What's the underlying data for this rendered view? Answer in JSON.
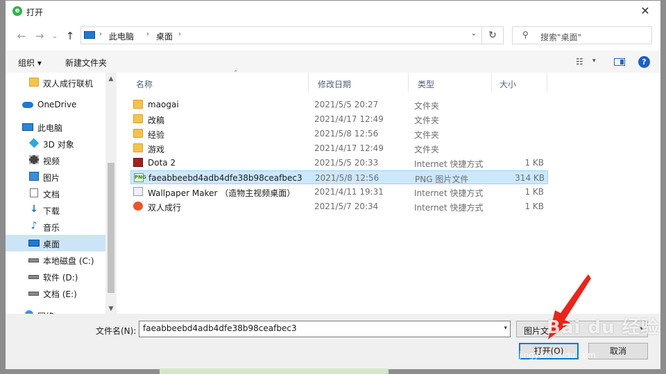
{
  "window": {
    "title": "打开",
    "close_glyph": "✕"
  },
  "nav": {
    "back_glyph": "←",
    "forward_glyph": "→",
    "recent_glyph": "⌄",
    "up_glyph": "↑",
    "address": {
      "crumbs": [
        "此电脑",
        "桌面"
      ],
      "sep_glyph": "›",
      "dropdown_glyph": "⌄",
      "refresh_glyph": "↻"
    },
    "search": {
      "placeholder": "搜索\"桌面\"",
      "icon": "search-icon"
    }
  },
  "toolbar": {
    "organize_label": "组织 ▾",
    "new_folder_label": "新建文件夹",
    "view_glyph": "☷",
    "view_dd": "▾",
    "help_glyph": "?"
  },
  "navpane": {
    "items": [
      {
        "label": "双人成行联机",
        "icon": "folder-icon"
      },
      {
        "label": "OneDrive",
        "icon": "cloud-icon"
      },
      {
        "label": "此电脑",
        "icon": "computer-icon"
      },
      {
        "label": "3D 对象",
        "icon": "cube-icon"
      },
      {
        "label": "视频",
        "icon": "video-icon"
      },
      {
        "label": "图片",
        "icon": "picture-icon"
      },
      {
        "label": "文档",
        "icon": "document-icon"
      },
      {
        "label": "下载",
        "icon": "download-icon",
        "glyph": "↓"
      },
      {
        "label": "音乐",
        "icon": "music-icon",
        "glyph": "♪"
      },
      {
        "label": "桌面",
        "icon": "desktop-icon",
        "selected": true
      },
      {
        "label": "本地磁盘 (C:)",
        "icon": "drive-icon"
      },
      {
        "label": "软件 (D:)",
        "icon": "drive-icon"
      },
      {
        "label": "文档 (E:)",
        "icon": "drive-icon"
      },
      {
        "label": "网络",
        "icon": "network-icon"
      }
    ],
    "scroll_up": "▲",
    "scroll_down": "▼"
  },
  "columns": {
    "name": "名称",
    "date": "修改日期",
    "type": "类型",
    "size": "大小",
    "sort_glyph": "⌃"
  },
  "files": [
    {
      "name": "maogai",
      "date": "2021/5/5 20:27",
      "type": "文件夹",
      "size": "",
      "icon": "folder"
    },
    {
      "name": "改稿",
      "date": "2021/4/17 12:49",
      "type": "文件夹",
      "size": "",
      "icon": "folder"
    },
    {
      "name": "经验",
      "date": "2021/5/8 12:56",
      "type": "文件夹",
      "size": "",
      "icon": "folder"
    },
    {
      "name": "游戏",
      "date": "2021/4/17 12:49",
      "type": "文件夹",
      "size": "",
      "icon": "folder"
    },
    {
      "name": "Dota 2",
      "date": "2021/5/5 20:33",
      "type": "Internet 快捷方式",
      "size": "1 KB",
      "icon": "dota"
    },
    {
      "name": "faeabbeebd4adb4dfe38b98ceafbec3",
      "date": "2021/5/8 12:56",
      "type": "PNG 图片文件",
      "size": "314 KB",
      "icon": "png",
      "selected": true
    },
    {
      "name": "Wallpaper Maker （造物主视频桌面）",
      "date": "2021/4/11 19:31",
      "type": "Internet 快捷方式",
      "size": "1 KB",
      "icon": "link"
    },
    {
      "name": "双人成行",
      "date": "2021/5/7 20:34",
      "type": "Internet 快捷方式",
      "size": "1 KB",
      "icon": "game"
    }
  ],
  "png_badge": "PNG",
  "bottom": {
    "filename_label": "文件名(N):",
    "filename_value": "faeabbeebd4adb4dfe38b98ceafbec3",
    "filetype_value": "图片文",
    "dd_glyph": "▾",
    "open_label": "打开(O)",
    "cancel_label": "取消"
  },
  "watermark": {
    "main": "Bai du 经验",
    "sub": "jingyan.baidu.com"
  },
  "colors": {
    "accent": "#0078d7",
    "selection": "#cce8ff",
    "arrow": "#e8261a"
  }
}
